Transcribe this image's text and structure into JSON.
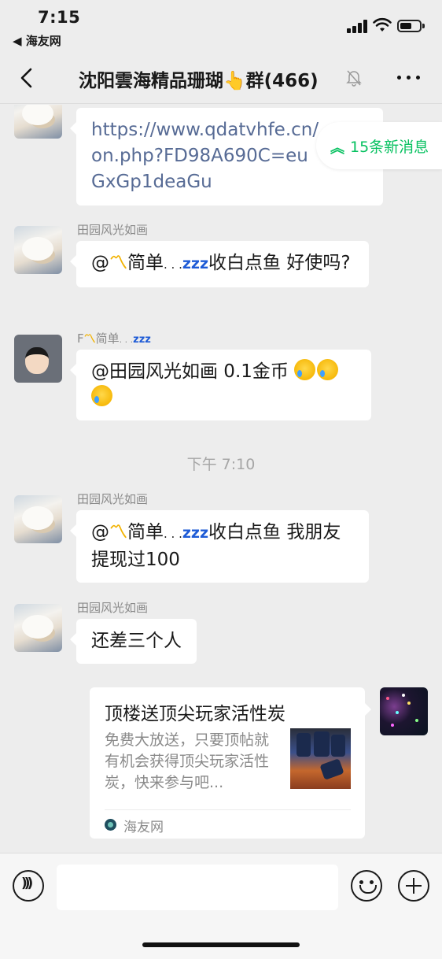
{
  "status_bar": {
    "time": "7:15",
    "back_app": "◀ 海友网"
  },
  "nav": {
    "title": "沈阳雲海精品珊瑚👆群(466)"
  },
  "new_messages": {
    "label": "15条新消息"
  },
  "messages": [
    {
      "type": "link_text",
      "text": "https://www.qdatvhfe.cn/on.php?FD98A690C=euGxGp1deaGu",
      "lines": [
        "https://www.qdatvhfe.cn/",
        "on.php?FD98A690C=eu",
        "GxGp1deaGu"
      ]
    },
    {
      "sender": "田园风光如画",
      "text": "@〽简单. . . zzz收白点鱼 好使吗?"
    },
    {
      "sender": "F〽简单. . . zzz",
      "text": "@田园风光如画 0.1金币"
    },
    {
      "sender": "田园风光如画",
      "text": "@〽简单. . . zzz收白点鱼 我朋友提现过100"
    },
    {
      "sender": "田园风光如画",
      "text": "还差三个人"
    }
  ],
  "timestamp": "下午 7:10",
  "share_card": {
    "title": "顶楼送顶尖玩家活性炭",
    "description": "免费大放送，只要顶帖就有机会获得顶尖玩家活性炭，快来参与吧...",
    "source": "海友网"
  },
  "icons": {
    "back": "chevron-left-icon",
    "mute": "bell-slash-icon",
    "more": "ellipsis-icon",
    "voice": "voice-icon",
    "emoji": "emoji-icon",
    "plus": "plus-icon"
  },
  "colors": {
    "accent_green": "#07c160",
    "link_blue": "#576b95",
    "background": "#ededed"
  }
}
